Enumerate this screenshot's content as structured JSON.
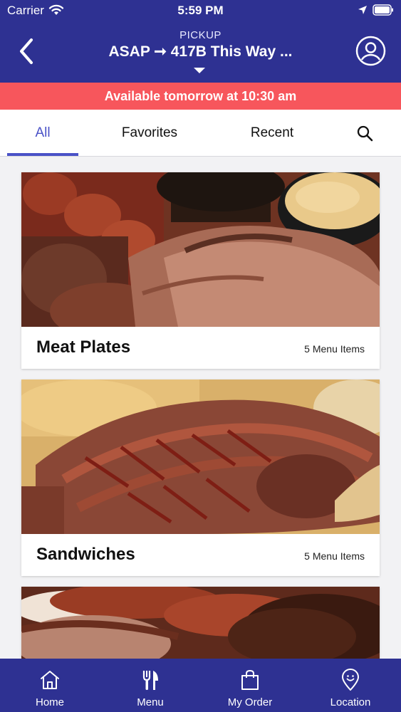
{
  "status_bar": {
    "carrier": "Carrier",
    "time": "5:59 PM"
  },
  "header": {
    "pickup_label": "PICKUP",
    "destination": "ASAP ➞ 417B This Way ...",
    "background": "#2e3192"
  },
  "banner": {
    "text": "Available tomorrow at 10:30 am",
    "color": "#f7565c"
  },
  "tabs": [
    {
      "label": "All",
      "active": true
    },
    {
      "label": "Favorites",
      "active": false
    },
    {
      "label": "Recent",
      "active": false
    }
  ],
  "accent_color": "#4a52c7",
  "categories": [
    {
      "title": "Meat Plates",
      "count": "5 Menu Items"
    },
    {
      "title": "Sandwiches",
      "count": "5 Menu Items"
    },
    {
      "title": "",
      "count": ""
    }
  ],
  "bottom_nav": [
    {
      "label": "Home",
      "icon": "home-icon"
    },
    {
      "label": "Menu",
      "icon": "fork-knife-icon"
    },
    {
      "label": "My Order",
      "icon": "shopping-bag-icon"
    },
    {
      "label": "Location",
      "icon": "location-pin-icon"
    }
  ]
}
